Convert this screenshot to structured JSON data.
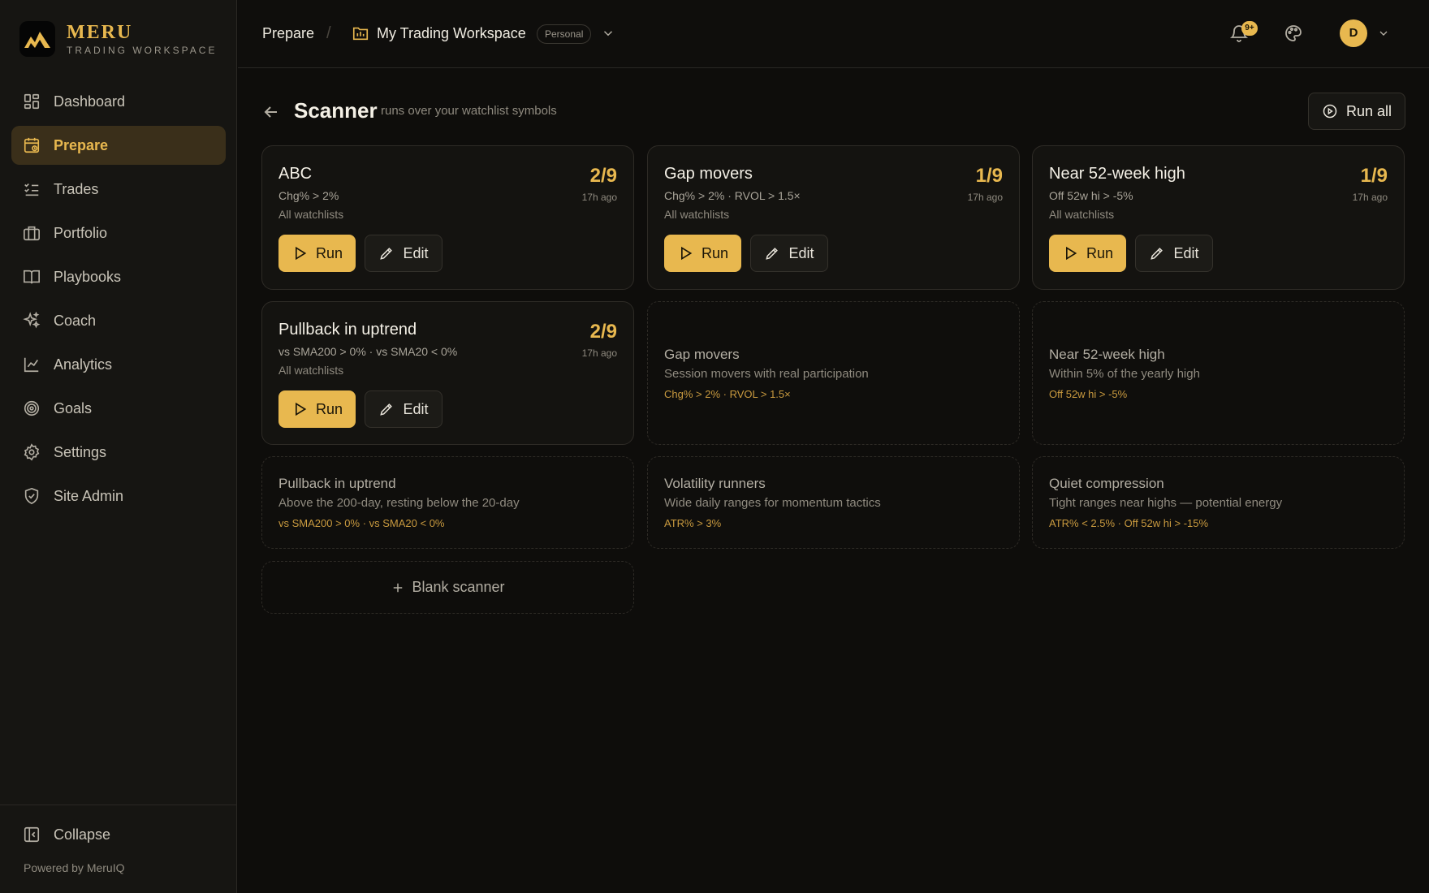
{
  "brand": {
    "name": "MERU",
    "subtitle": "TRADING WORKSPACE"
  },
  "sidebar": {
    "items": [
      {
        "label": "Dashboard",
        "icon": "dashboard-icon"
      },
      {
        "label": "Prepare",
        "icon": "calendar-clock-icon",
        "active": true
      },
      {
        "label": "Trades",
        "icon": "list-checks-icon"
      },
      {
        "label": "Portfolio",
        "icon": "briefcase-icon"
      },
      {
        "label": "Playbooks",
        "icon": "book-open-icon"
      },
      {
        "label": "Coach",
        "icon": "sparkles-icon"
      },
      {
        "label": "Analytics",
        "icon": "line-chart-icon"
      },
      {
        "label": "Goals",
        "icon": "target-icon"
      },
      {
        "label": "Settings",
        "icon": "gear-icon"
      },
      {
        "label": "Site Admin",
        "icon": "shield-icon"
      }
    ],
    "collapse_label": "Collapse",
    "powered_by": "Powered by MeruIQ"
  },
  "topbar": {
    "breadcrumb": "Prepare",
    "separator": "/",
    "workspace_name": "My Trading Workspace",
    "workspace_badge": "Personal",
    "notifications_badge": "9+",
    "avatar_initial": "D"
  },
  "page": {
    "title": "Scanner",
    "subtitle": "runs over your watchlist symbols",
    "run_all_label": "Run all"
  },
  "scanners": [
    {
      "name": "ABC",
      "filter": "Chg% > 2%",
      "scope": "All watchlists",
      "count": "2/9",
      "ago": "17h ago",
      "run_label": "Run",
      "edit_label": "Edit"
    },
    {
      "name": "Gap movers",
      "filter": "Chg% > 2% · RVOL > 1.5×",
      "scope": "All watchlists",
      "count": "1/9",
      "ago": "17h ago",
      "run_label": "Run",
      "edit_label": "Edit"
    },
    {
      "name": "Near 52-week high",
      "filter": "Off 52w hi > -5%",
      "scope": "All watchlists",
      "count": "1/9",
      "ago": "17h ago",
      "run_label": "Run",
      "edit_label": "Edit"
    },
    {
      "name": "Pullback in uptrend",
      "filter": "vs SMA200 > 0% · vs SMA20 < 0%",
      "scope": "All watchlists",
      "count": "2/9",
      "ago": "17h ago",
      "run_label": "Run",
      "edit_label": "Edit"
    }
  ],
  "templates": [
    {
      "name": "Gap movers",
      "desc": "Session movers with real participation",
      "expr": "Chg% > 2% · RVOL > 1.5×"
    },
    {
      "name": "Near 52-week high",
      "desc": "Within 5% of the yearly high",
      "expr": "Off 52w hi > -5%"
    },
    {
      "name": "Pullback in uptrend",
      "desc": "Above the 200-day, resting below the 20-day",
      "expr": "vs SMA200 > 0% · vs SMA20 < 0%"
    },
    {
      "name": "Volatility runners",
      "desc": "Wide daily ranges for momentum tactics",
      "expr": "ATR% > 3%"
    },
    {
      "name": "Quiet compression",
      "desc": "Tight ranges near highs — potential energy",
      "expr": "ATR% < 2.5% · Off 52w hi > -15%"
    }
  ],
  "blank_label": "Blank scanner",
  "colors": {
    "accent": "#e8b84f",
    "background": "#0e0d0b",
    "sidebar": "#161512",
    "active_nav": "#3a2f1a"
  }
}
